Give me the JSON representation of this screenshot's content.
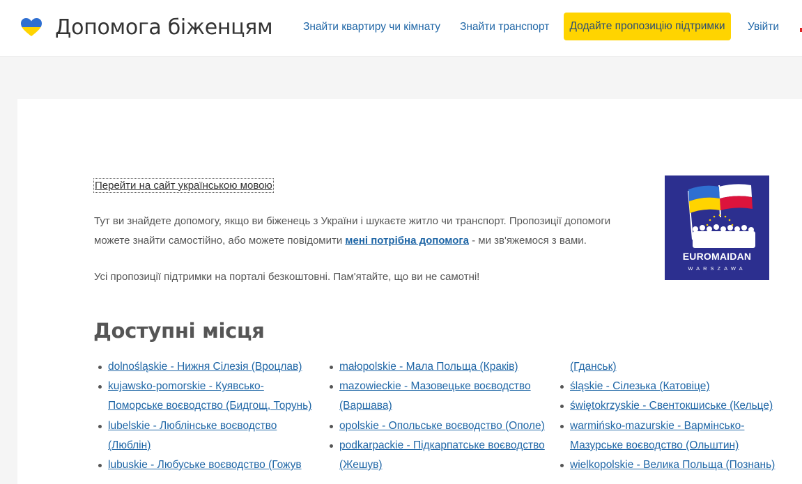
{
  "header": {
    "site_title": "Допомога біженцям",
    "nav": {
      "find_apartment": "Знайти квартиру чи кімнату",
      "find_transport": "Знайти транспорт",
      "add_offer": "Додайте пропозицію підтримки",
      "login": "Увійти"
    }
  },
  "content": {
    "lang_link": "Перейти на сайт українською мовою",
    "intro_part1": "Тут ви знайдете допомогу, якщо ви біженець з України і шукаєте житло чи транспорт. Пропозиції допомоги можете знайти самостійно, або можете повідомити ",
    "intro_link": "мені потрібна допомога",
    "intro_part2": " - ми зв'яжемося з вами.",
    "free_note": "Усі пропозиції підтримки на порталі безкоштовні. Пам'ятайте, що ви не самотні!",
    "badge": {
      "name": "EUROMAIDAN",
      "sub": "WARSZAWA"
    },
    "section_title": "Доступні місця"
  },
  "regions": {
    "col1": [
      {
        "text": "dolnośląskie - Нижня Сілезія (Вроцлав)"
      },
      {
        "text": "kujawsko-pomorskie - Куявсько-Поморське воєводство (Бидгощ, Торунь)"
      },
      {
        "text": "lubelskie - Люблінське воєводство (Люблін)"
      },
      {
        "text": "lubuskie - Любуське воєводство (Гожув"
      }
    ],
    "col2": [
      {
        "text": "małopolskie - Мала Польща (Краків)"
      },
      {
        "text": "mazowieckie - Мазовецьке воєводство (Варшава)"
      },
      {
        "text": "opolskie - Опольське воєводство (Ополе)"
      },
      {
        "text": "podkarpackie - Підкарпатське воєводство (Жешув)"
      }
    ],
    "col3": [
      {
        "text": "(Гданськ)"
      },
      {
        "text": "śląskie - Сілезька (Катовіце)"
      },
      {
        "text": "świętokrzyskie - Свентокшиське (Кельце)"
      },
      {
        "text": "warmińsko-mazurskie - Вармінсько-Мазурське воєводство (Ольштин)"
      },
      {
        "text": "wielkopolskie - Велика Польща (Познань)"
      }
    ]
  },
  "colors": {
    "link": "#1f66a6",
    "cta_background": "#ffd400",
    "badge_background": "#2c2f8f",
    "page_background": "#f5f5f5"
  },
  "icons": {
    "logo": "heart-ukraine-icon"
  }
}
